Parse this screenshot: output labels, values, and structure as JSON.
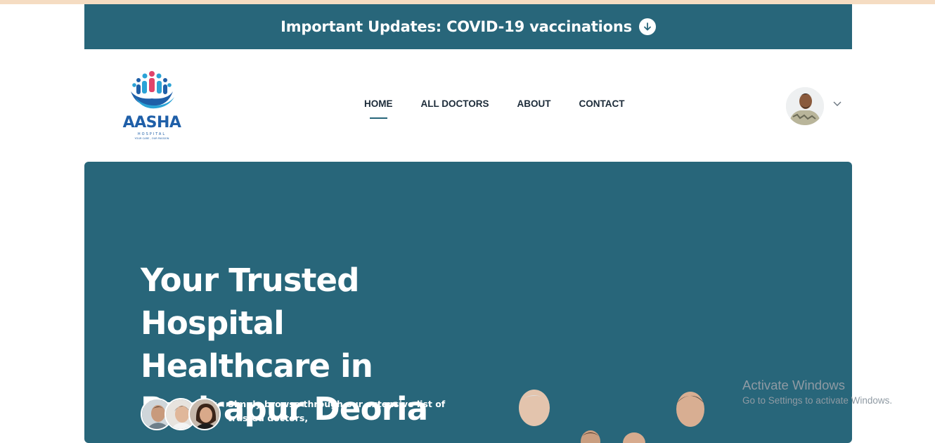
{
  "banner": {
    "text": "Important Updates: COVID-19 vaccinations",
    "icon": "arrow-down-circle-icon"
  },
  "logo": {
    "name": "AASHA",
    "sub": "HOSPITAL",
    "tagline": "YOUR CARE , OUR PASSION"
  },
  "nav": {
    "items": [
      {
        "label": "HOME",
        "active": true
      },
      {
        "label": "ALL DOCTORS",
        "active": false
      },
      {
        "label": "ABOUT",
        "active": false
      },
      {
        "label": "CONTACT",
        "active": false
      }
    ]
  },
  "user": {
    "avatar_icon": "user-avatar",
    "dropdown_icon": "chevron-down-icon"
  },
  "hero": {
    "title_line1": "Your Trusted Hospital",
    "title_line2": "Healthcare in",
    "title_line3": "Rudrapur Deoria",
    "description": "Simply browse through our extensive list of trusted doctors,"
  },
  "watermark": {
    "title": "Activate Windows",
    "subtitle": "Go to Settings to activate Windows."
  },
  "colors": {
    "primary": "#28667a",
    "top_strip": "#f5dcc2",
    "nav_text": "#1c2b39"
  }
}
